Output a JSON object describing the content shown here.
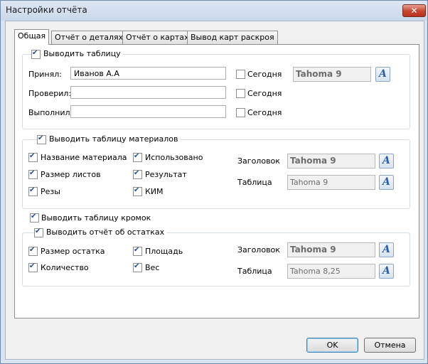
{
  "window": {
    "title": "Настройки отчёта",
    "close_symbol": "✕"
  },
  "tabs": [
    {
      "label": "Общая",
      "active": true
    },
    {
      "label": "Отчёт о деталях",
      "active": false
    },
    {
      "label": "Отчёт о картах",
      "active": false
    },
    {
      "label": "Вывод карт раскроя",
      "active": false
    }
  ],
  "table_group": {
    "title": "Выводить таблицу",
    "checked": true,
    "rows": [
      {
        "label": "Принял:",
        "value": "Иванов А.А",
        "today_label": "Сегодня",
        "today_checked": false
      },
      {
        "label": "Проверил:",
        "value": "",
        "today_label": "Сегодня",
        "today_checked": false
      },
      {
        "label": "Выполнил:",
        "value": "",
        "today_label": "Сегодня",
        "today_checked": false
      }
    ],
    "font": "Tahoma  9"
  },
  "materials_group": {
    "title": "Выводить таблицу материалов",
    "checked": true,
    "left": [
      {
        "label": "Название материала",
        "checked": true
      },
      {
        "label": "Размер листов",
        "checked": true
      },
      {
        "label": "Резы",
        "checked": true
      }
    ],
    "right": [
      {
        "label": "Использовано",
        "checked": true
      },
      {
        "label": "Результат",
        "checked": true
      },
      {
        "label": "КИМ",
        "checked": true
      }
    ],
    "header_label": "Заголовок",
    "header_font": "Tahoma  9",
    "table_label": "Таблица",
    "table_font": "Tahoma  9"
  },
  "edges": {
    "label": "Выводить таблицу кромок",
    "checked": true
  },
  "remains_group": {
    "title": "Выводить отчёт об остатках",
    "checked": true,
    "left": [
      {
        "label": "Размер остатка",
        "checked": true
      },
      {
        "label": "Количество",
        "checked": true
      }
    ],
    "right": [
      {
        "label": "Площадь",
        "checked": true
      },
      {
        "label": "Вес",
        "checked": true
      }
    ],
    "header_label": "Заголовок",
    "header_font": "Tahoma  9",
    "table_label": "Таблица",
    "table_font": "Tahoma 8,25"
  },
  "font_button_glyph": "A",
  "buttons": {
    "ok": "OK",
    "cancel": "Отмена"
  }
}
